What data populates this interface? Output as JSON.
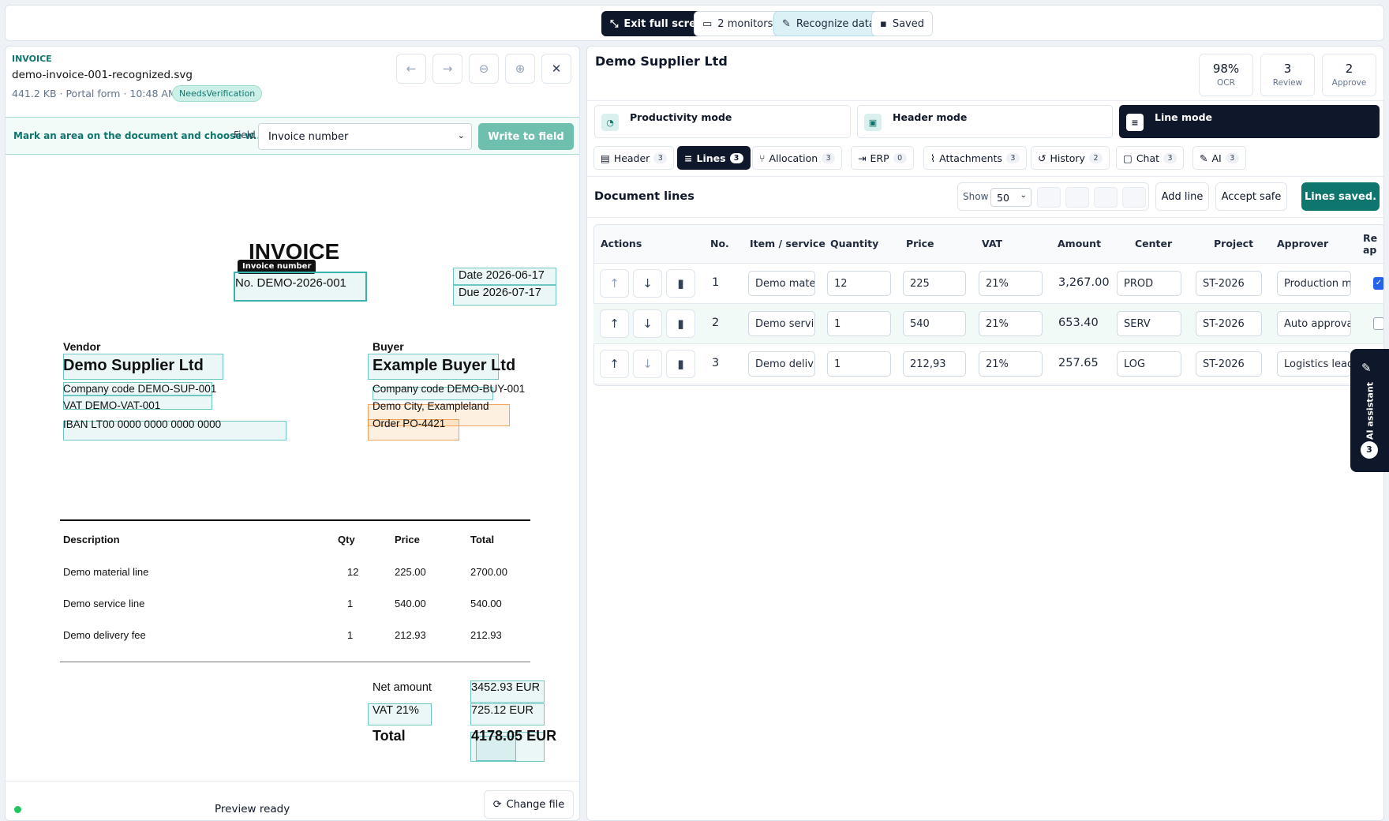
{
  "toolbar": {
    "exit_fullscreen": "Exit full screen",
    "monitors": "2 monitors",
    "recognize": "Recognize data",
    "saved": "Saved"
  },
  "file": {
    "kind": "INVOICE",
    "name": "demo-invoice-001-recognized.svg",
    "meta": "441.2 KB · Portal form · 10:48 AM",
    "status": "NeedsVerification"
  },
  "mapping": {
    "hint": "Mark an area on the document and choose w...",
    "field_label": "Field",
    "field_value": "Invoice number",
    "write_button": "Write to field"
  },
  "document": {
    "title": "INVOICE",
    "tag": "Invoice number",
    "number": "No. DEMO-2026-001",
    "date": "Date 2026-06-17",
    "due": "Due 2026-07-17",
    "vendor": {
      "label": "Vendor",
      "name": "Demo Supplier Ltd",
      "code": "Company code DEMO-SUP-001",
      "vat": "VAT DEMO-VAT-001",
      "iban": "IBAN LT00 0000 0000 0000 0000"
    },
    "buyer": {
      "label": "Buyer",
      "name": "Example Buyer Ltd",
      "code": "Company code DEMO-BUY-001",
      "city": "Demo City, Exampleland",
      "order": "Order PO-4421"
    },
    "headers": {
      "description": "Description",
      "qty": "Qty",
      "price": "Price",
      "total": "Total"
    },
    "rows": [
      {
        "description": "Demo material line",
        "qty": "12",
        "price": "225.00",
        "total": "2700.00"
      },
      {
        "description": "Demo service line",
        "qty": "1",
        "price": "540.00",
        "total": "540.00"
      },
      {
        "description": "Demo delivery fee",
        "qty": "1",
        "price": "212.93",
        "total": "212.93"
      }
    ],
    "net_label": "Net amount",
    "net_value": "3452.93 EUR",
    "vat_label": "VAT 21%",
    "vat_value": "725.12 EUR",
    "total_label": "Total",
    "total_value": "4178.05 EUR"
  },
  "footer": {
    "status": "Preview ready",
    "change_file": "Change file",
    "status_color": "#22c55e"
  },
  "supplier": {
    "name": "Demo Supplier Ltd"
  },
  "stats": [
    {
      "value": "98%",
      "label": "OCR"
    },
    {
      "value": "3",
      "label": "Review"
    },
    {
      "value": "2",
      "label": "Approve"
    }
  ],
  "modes": [
    {
      "label": "Productivity mode"
    },
    {
      "label": "Header mode"
    },
    {
      "label": "Line mode"
    }
  ],
  "tabs": [
    {
      "label": "Header",
      "count": "3"
    },
    {
      "label": "Lines",
      "count": "3"
    },
    {
      "label": "Allocation",
      "count": "3"
    },
    {
      "label": "ERP",
      "count": "0"
    },
    {
      "label": "Attachments",
      "count": "3"
    },
    {
      "label": "History",
      "count": "2"
    },
    {
      "label": "Chat",
      "count": "3"
    },
    {
      "label": "AI",
      "count": "3"
    }
  ],
  "lines": {
    "title": "Document lines",
    "show_label": "Show",
    "page_size": "50",
    "add_line": "Add line",
    "accept_safe": "Accept safe",
    "saved_button": "Lines saved.",
    "columns": {
      "actions": "Actions",
      "no": "No.",
      "item": "Item / service",
      "quantity": "Quantity",
      "price": "Price",
      "vat": "VAT",
      "amount": "Amount",
      "center": "Center",
      "project": "Project",
      "approver": "Approver",
      "review": "Re ap"
    },
    "rows": [
      {
        "no": "1",
        "item": "Demo mate",
        "quantity": "12",
        "price": "225",
        "vat": "21%",
        "amount": "3,267.00",
        "center": "PROD",
        "project": "ST-2026",
        "approver": "Production m",
        "checked": true
      },
      {
        "no": "2",
        "item": "Demo servi",
        "quantity": "1",
        "price": "540",
        "vat": "21%",
        "amount": "653.40",
        "center": "SERV",
        "project": "ST-2026",
        "approver": "Auto approva",
        "checked": false
      },
      {
        "no": "3",
        "item": "Demo deliv",
        "quantity": "1",
        "price": "212,93",
        "vat": "21%",
        "amount": "257.65",
        "center": "LOG",
        "project": "ST-2026",
        "approver": "Logistics lead",
        "checked": false
      }
    ]
  },
  "assistant": {
    "label": "AI assistant",
    "count": "3"
  },
  "colors": {
    "teal": "#0f766e",
    "dark": "#0f172a",
    "accent_bg": "#dcf1f6"
  }
}
